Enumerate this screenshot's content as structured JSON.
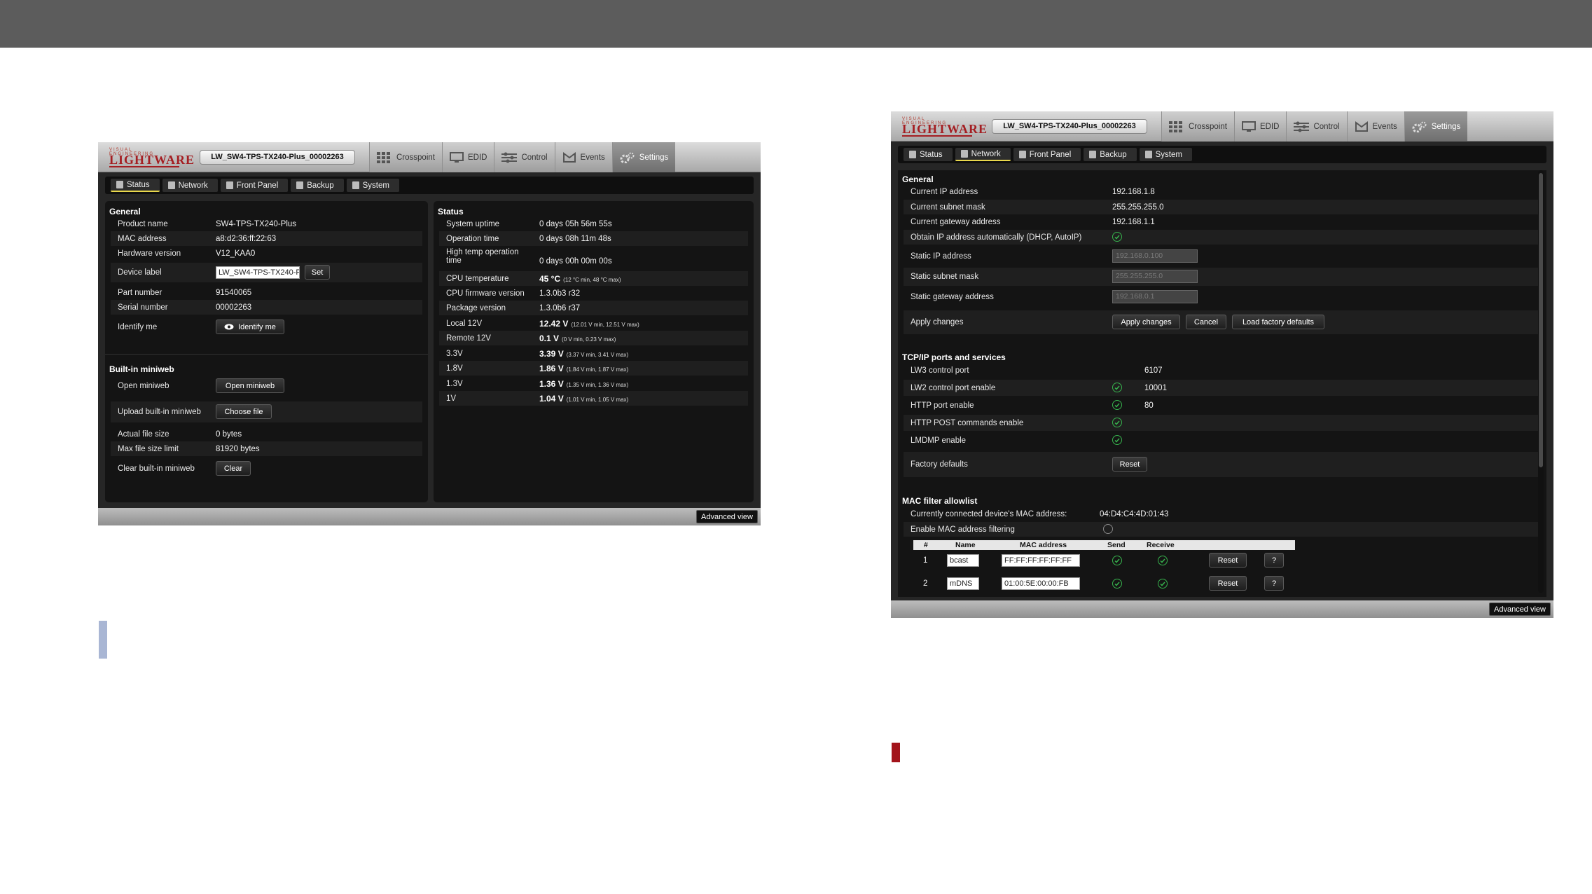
{
  "app": {
    "logo_tag": "VISUAL ENGINEERING",
    "logo_word": "LIGHTWARE",
    "device_label": "LW_SW4-TPS-TX240-Plus_00002263",
    "nav_tabs": [
      "Crosspoint",
      "EDID",
      "Control",
      "Events",
      "Settings"
    ],
    "sub_tabs": [
      "Status",
      "Network",
      "Front Panel",
      "Backup",
      "System"
    ],
    "advanced_view": "Advanced view"
  },
  "status_page": {
    "general_title": "General",
    "general": [
      {
        "label": "Product name",
        "value": "SW4-TPS-TX240-Plus"
      },
      {
        "label": "MAC address",
        "value": "a8:d2:36:ff:22:63"
      },
      {
        "label": "Hardware version",
        "value": "V12_KAA0"
      },
      {
        "label": "Device label",
        "value": "LW_SW4-TPS-TX240-P"
      },
      {
        "label": "Part number",
        "value": "91540065"
      },
      {
        "label": "Serial number",
        "value": "00002263"
      },
      {
        "label": "Identify me",
        "value": "Identify me"
      }
    ],
    "set_button": "Set",
    "miniweb_title": "Built-in miniweb",
    "miniweb": [
      {
        "label": "Open miniweb",
        "value": "Open miniweb"
      },
      {
        "label": "Upload built-in miniweb",
        "value": "Choose file"
      },
      {
        "label": "Actual file size",
        "value": "0 bytes"
      },
      {
        "label": "Max file size limit",
        "value": "81920 bytes"
      },
      {
        "label": "Clear built-in miniweb",
        "value": "Clear"
      }
    ],
    "status_title": "Status",
    "status": [
      {
        "label": "System uptime",
        "value": "0 days 05h 56m 55s",
        "note": ""
      },
      {
        "label": "Operation time",
        "value": "0 days 08h 11m 48s",
        "note": ""
      },
      {
        "label": "High temp operation",
        "label2": "time",
        "value": "0 days 00h 00m 00s",
        "note": ""
      },
      {
        "label": "CPU temperature",
        "value": "45 °C",
        "note": "(12 °C min, 48 °C max)"
      },
      {
        "label": "CPU firmware version",
        "value": "1.3.0b3 r32",
        "note": ""
      },
      {
        "label": "Package version",
        "value": "1.3.0b6 r37",
        "note": ""
      },
      {
        "label": "Local 12V",
        "value": "12.42 V",
        "note": "(12.01 V min, 12.51 V max)"
      },
      {
        "label": "Remote 12V",
        "value": "0.1 V",
        "note": "(0 V min, 0.23 V max)"
      },
      {
        "label": "3.3V",
        "value": "3.39 V",
        "note": "(3.37 V min, 3.41 V max)"
      },
      {
        "label": "1.8V",
        "value": "1.86 V",
        "note": "(1.84 V min, 1.87 V max)"
      },
      {
        "label": "1.3V",
        "value": "1.36 V",
        "note": "(1.35 V min, 1.36 V max)"
      },
      {
        "label": "1V",
        "value": "1.04 V",
        "note": "(1.01 V min, 1.05 V max)"
      }
    ]
  },
  "network_page": {
    "general_title": "General",
    "general": [
      {
        "label": "Current IP address",
        "value": "192.168.1.8"
      },
      {
        "label": "Current subnet mask",
        "value": "255.255.255.0"
      },
      {
        "label": "Current gateway address",
        "value": "192.168.1.1"
      },
      {
        "label": "Obtain IP address automatically (DHCP, AutoIP)",
        "value": ""
      },
      {
        "label": "Static IP address",
        "value": "192.168.0.100"
      },
      {
        "label": "Static subnet mask",
        "value": "255.255.255.0"
      },
      {
        "label": "Static gateway address",
        "value": "192.168.0.1"
      },
      {
        "label": "Apply changes",
        "value": ""
      }
    ],
    "apply_buttons": [
      "Apply changes",
      "Cancel",
      "Load factory defaults"
    ],
    "tcp_title": "TCP/IP ports and services",
    "tcp": [
      {
        "label": "LW3 control port",
        "value": "6107"
      },
      {
        "label": "LW2 control port enable",
        "value": "10001"
      },
      {
        "label": "HTTP port enable",
        "value": "80"
      },
      {
        "label": "HTTP POST commands enable",
        "value": ""
      },
      {
        "label": "LMDMP enable",
        "value": ""
      },
      {
        "label": "Factory defaults",
        "value": "Reset"
      }
    ],
    "mac_title": "MAC filter allowlist",
    "mac_current_label": "Currently connected device's MAC address:",
    "mac_current_value": "04:D4:C4:4D:01:43",
    "mac_enable_label": "Enable MAC address filtering",
    "mac_headers": [
      "#",
      "Name",
      "MAC address",
      "Send",
      "Receive"
    ],
    "mac_rows": [
      {
        "num": "1",
        "name": "bcast",
        "mac": "FF:FF:FF:FF:FF:FF",
        "reset": "Reset",
        "help": "?"
      },
      {
        "num": "2",
        "name": "mDNS",
        "mac": "01:00:5E:00:00:FB",
        "reset": "Reset",
        "help": "?"
      }
    ]
  }
}
